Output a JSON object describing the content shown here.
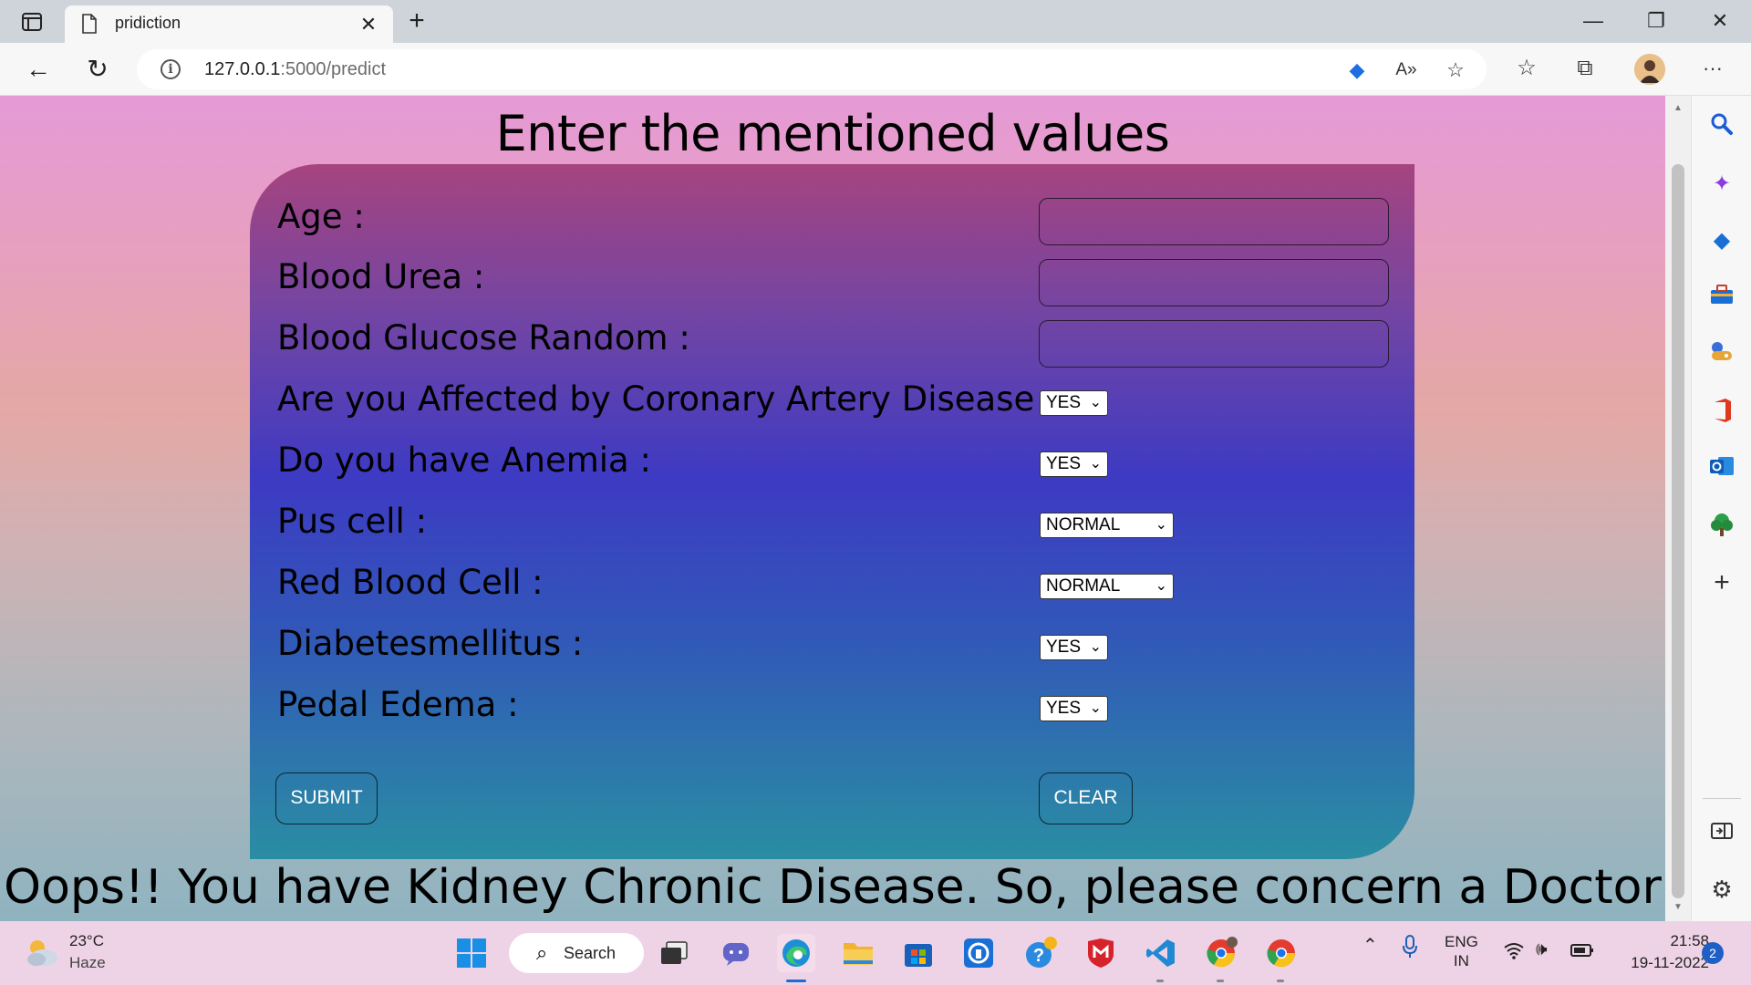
{
  "browser": {
    "tab_title": "pridiction",
    "url_host": "127.0.0.1",
    "url_rest": ":5000/predict"
  },
  "page": {
    "title": "Enter the mentioned values",
    "fields": {
      "age": {
        "label": "Age :",
        "value": ""
      },
      "blood_urea": {
        "label": "Blood Urea :",
        "value": ""
      },
      "blood_glucose": {
        "label": "Blood Glucose Random :",
        "value": ""
      },
      "coronary": {
        "label": "Are you Affected by Coronary Artery Disease :",
        "selected": "YES"
      },
      "anemia": {
        "label": "Do you have Anemia :",
        "selected": "YES"
      },
      "pus_cell": {
        "label": "Pus cell :",
        "selected": "NORMAL"
      },
      "red_blood_cell": {
        "label": "Red Blood Cell :",
        "selected": "NORMAL"
      },
      "diabetes": {
        "label": "Diabetesmellitus :",
        "selected": "YES"
      },
      "pedal_edema": {
        "label": "Pedal Edema :",
        "selected": "YES"
      }
    },
    "submit_label": "SUBMIT",
    "clear_label": "CLEAR",
    "result": "Oops!! You have Kidney Chronic Disease. So, please concern a Doctor"
  },
  "taskbar": {
    "temperature": "23°C",
    "weather": "Haze",
    "search_label": "Search",
    "lang_top": "ENG",
    "lang_bottom": "IN",
    "time": "21:58",
    "date": "19-11-2022",
    "notifications": "2"
  },
  "icons": {
    "sidebar": [
      "search-icon",
      "copilot-icon",
      "shopping-tag-icon",
      "tools-icon",
      "games-icon",
      "office-icon",
      "outlook-icon",
      "tree-icon",
      "add-icon",
      "split-screen-icon",
      "settings-icon"
    ]
  }
}
